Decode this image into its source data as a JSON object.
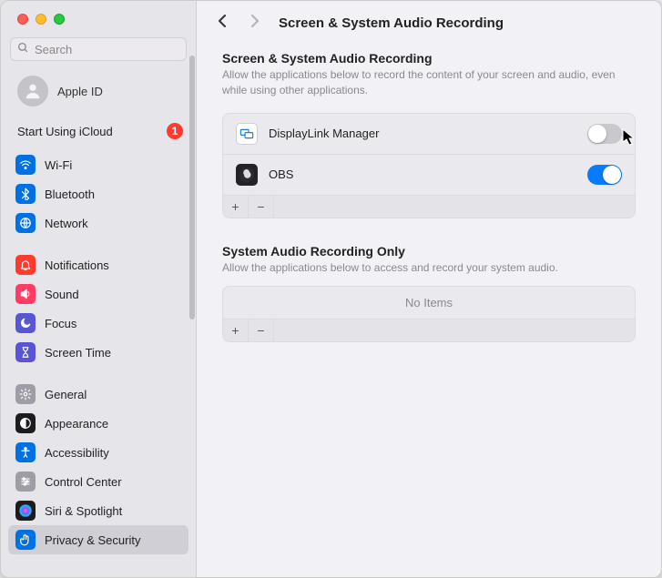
{
  "sidebar": {
    "search_placeholder": "Search",
    "apple_id_label": "Apple ID",
    "icloud_label": "Start Using iCloud",
    "icloud_badge": "1",
    "items": [
      {
        "label": "Wi-Fi",
        "icon_bg": "#0071e3",
        "glyph": "wifi"
      },
      {
        "label": "Bluetooth",
        "icon_bg": "#0071e3",
        "glyph": "bluetooth"
      },
      {
        "label": "Network",
        "icon_bg": "#0071e3",
        "glyph": "globe"
      },
      {
        "gap": true
      },
      {
        "label": "Notifications",
        "icon_bg": "#ff3b30",
        "glyph": "bell"
      },
      {
        "label": "Sound",
        "icon_bg": "#ff3b66",
        "glyph": "speaker"
      },
      {
        "label": "Focus",
        "icon_bg": "#5856d6",
        "glyph": "moon"
      },
      {
        "label": "Screen Time",
        "icon_bg": "#5856d6",
        "glyph": "hourglass"
      },
      {
        "gap": true
      },
      {
        "label": "General",
        "icon_bg": "#9e9ea6",
        "glyph": "gear"
      },
      {
        "label": "Appearance",
        "icon_bg": "#1c1c1e",
        "glyph": "appearance"
      },
      {
        "label": "Accessibility",
        "icon_bg": "#0071e3",
        "glyph": "accessibility"
      },
      {
        "label": "Control Center",
        "icon_bg": "#9e9ea6",
        "glyph": "sliders"
      },
      {
        "label": "Siri & Spotlight",
        "icon_bg": "#1c1c1e",
        "glyph": "siri"
      },
      {
        "label": "Privacy & Security",
        "icon_bg": "#0071e3",
        "glyph": "hand",
        "selected": true
      }
    ]
  },
  "header": {
    "title": "Screen & System Audio Recording"
  },
  "section1": {
    "title": "Screen & System Audio Recording",
    "desc": "Allow the applications below to record the content of your screen and audio, even while using other applications.",
    "apps": [
      {
        "name": "DisplayLink Manager",
        "icon_bg": "#ffffff",
        "icon_border": "#d0d0d0",
        "icon_glyph": "displaylink",
        "enabled": false
      },
      {
        "name": "OBS",
        "icon_bg": "#222228",
        "icon_glyph": "obs",
        "enabled": true
      }
    ],
    "add_label": "+",
    "remove_label": "−"
  },
  "section2": {
    "title": "System Audio Recording Only",
    "desc": "Allow the applications below to access and record your system audio.",
    "empty_label": "No Items",
    "add_label": "+",
    "remove_label": "−"
  }
}
